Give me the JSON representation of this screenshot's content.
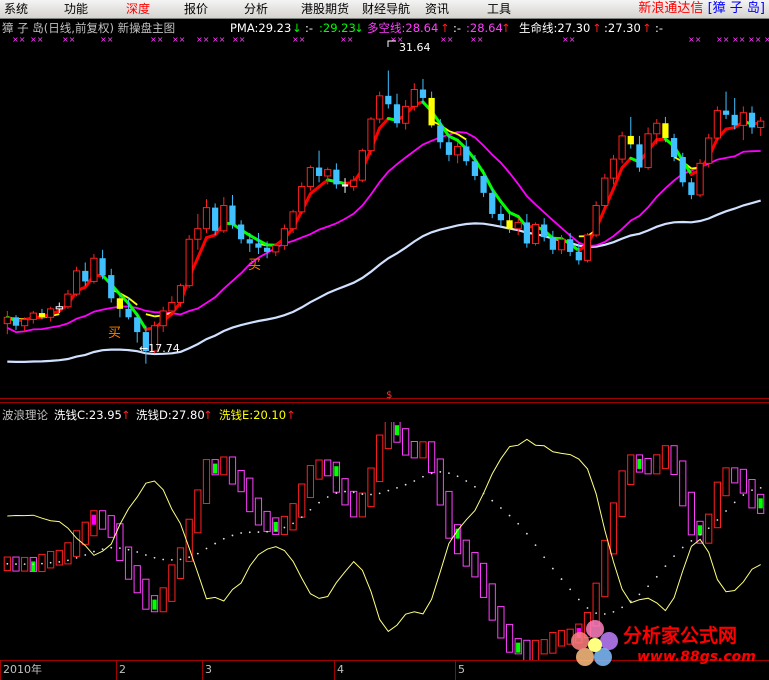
{
  "menu": {
    "items": [
      {
        "label": "系统",
        "key": "system"
      },
      {
        "label": "功能",
        "key": "function"
      },
      {
        "label": "深度",
        "key": "depth",
        "active": true
      },
      {
        "label": "报价",
        "key": "quote"
      },
      {
        "label": "分析",
        "key": "analysis"
      },
      {
        "label": "港股期货",
        "key": "hk-futures"
      },
      {
        "label": "财经导航",
        "key": "finance-nav"
      },
      {
        "label": "资讯",
        "key": "news"
      },
      {
        "label": "工具",
        "key": "tools"
      }
    ],
    "brand": "新浪通达信",
    "stock_box": "[獐 子 岛]"
  },
  "price_header": {
    "stock_title": "獐 子 岛(日线,前复权) 新操盘主图",
    "pma_label": "PMA:29.23",
    "pma_arrow": "↓",
    "pma_dash": ":-",
    "pma_value2": ":29.23",
    "pma_arrow2": "↓",
    "duokong_label": "多空线:28.64",
    "duokong_arrow": "↑",
    "duokong_dash": ":-",
    "duokong_value2": ":28.64",
    "duokong_arrow2": "↑",
    "life_label": "生命线:27.30",
    "life_arrow": "↑",
    "life_value2": ":27.30",
    "life_arrow2": "↑",
    "tail": ":-"
  },
  "price_annotations": {
    "high_label": "31.64",
    "low_label": "←17.74",
    "buy_label_1": "买",
    "buy_label_2": "买"
  },
  "separator_mark": "$",
  "wave_header": {
    "indicator_name": "波浪理论",
    "c_label": "洗钱C:23.95",
    "c_arrow": "↑",
    "d_label": "洗钱D:27.80",
    "d_arrow": "↑",
    "e_label": "洗钱E:20.10",
    "e_arrow": "↑"
  },
  "date_axis": [
    "2010年",
    "2",
    "3",
    "4",
    "5"
  ],
  "watermark": {
    "title": "分析家公式网",
    "url": "www.88gs.com"
  },
  "colors": {
    "up_candle": "#ff2020",
    "down_candle": "#40c0ff",
    "doji": "#ffffff",
    "ma_red": "#ff0000",
    "ma_green": "#00ff00",
    "ma_yellow": "#ffff00",
    "ma_magenta": "#ff00ff",
    "ma_life": "#d0e0ff",
    "gold": "#ffff00",
    "wave_up": "#ff2020",
    "wave_down": "#ff40ff",
    "wave_line": "#ffff80"
  },
  "chart_data": {
    "type": "candlestick",
    "price_ylim": [
      16.5,
      33
    ],
    "ohlc": [
      [
        19.6,
        20.2,
        19.1,
        19.9
      ],
      [
        19.9,
        20.0,
        19.3,
        19.5
      ],
      [
        19.5,
        19.9,
        19.2,
        19.8
      ],
      [
        19.8,
        20.2,
        19.6,
        20.1
      ],
      [
        20.1,
        20.3,
        19.8,
        19.9
      ],
      [
        19.9,
        20.4,
        19.7,
        20.3
      ],
      [
        20.3,
        20.6,
        20.1,
        20.4
      ],
      [
        20.4,
        21.2,
        20.3,
        21.0
      ],
      [
        21.0,
        22.3,
        20.9,
        22.1
      ],
      [
        22.1,
        22.5,
        21.4,
        21.6
      ],
      [
        21.6,
        22.9,
        21.5,
        22.7
      ],
      [
        22.7,
        23.1,
        21.7,
        21.9
      ],
      [
        21.9,
        22.2,
        20.6,
        20.8
      ],
      [
        20.8,
        21.0,
        19.9,
        20.3
      ],
      [
        20.3,
        20.8,
        19.8,
        19.9
      ],
      [
        19.9,
        20.1,
        18.7,
        19.2
      ],
      [
        19.2,
        19.5,
        17.7,
        18.3
      ],
      [
        18.3,
        19.7,
        18.2,
        19.5
      ],
      [
        19.5,
        20.4,
        19.2,
        20.2
      ],
      [
        20.2,
        20.9,
        20.0,
        20.6
      ],
      [
        20.6,
        21.5,
        20.4,
        21.4
      ],
      [
        21.4,
        23.8,
        21.3,
        23.6
      ],
      [
        23.6,
        24.8,
        23.1,
        24.1
      ],
      [
        24.1,
        25.5,
        23.9,
        25.1
      ],
      [
        25.1,
        25.3,
        23.8,
        24.0
      ],
      [
        24.0,
        25.6,
        23.9,
        25.2
      ],
      [
        25.2,
        25.7,
        24.1,
        24.3
      ],
      [
        24.3,
        24.5,
        23.4,
        23.6
      ],
      [
        23.6,
        23.9,
        23.0,
        23.4
      ],
      [
        23.4,
        23.9,
        22.9,
        23.2
      ],
      [
        23.2,
        23.5,
        22.7,
        23.0
      ],
      [
        23.0,
        23.4,
        22.8,
        23.3
      ],
      [
        23.3,
        24.3,
        23.1,
        24.1
      ],
      [
        24.1,
        25.0,
        23.9,
        24.9
      ],
      [
        24.9,
        26.3,
        24.8,
        26.1
      ],
      [
        26.1,
        27.1,
        25.9,
        27.0
      ],
      [
        27.0,
        27.8,
        26.3,
        26.6
      ],
      [
        26.6,
        27.0,
        26.2,
        26.9
      ],
      [
        26.9,
        27.2,
        26.0,
        26.2
      ],
      [
        26.2,
        26.5,
        25.8,
        26.1
      ],
      [
        26.1,
        26.6,
        25.9,
        26.4
      ],
      [
        26.4,
        27.9,
        26.3,
        27.8
      ],
      [
        27.8,
        29.4,
        27.6,
        29.3
      ],
      [
        29.3,
        30.6,
        29.1,
        30.4
      ],
      [
        30.4,
        31.6,
        29.8,
        30.0
      ],
      [
        30.0,
        30.5,
        28.9,
        29.1
      ],
      [
        29.1,
        30.2,
        28.8,
        29.9
      ],
      [
        29.9,
        31.0,
        29.7,
        30.7
      ],
      [
        30.7,
        31.2,
        30.0,
        30.3
      ],
      [
        30.3,
        30.6,
        28.9,
        29.0
      ],
      [
        29.0,
        29.3,
        27.9,
        28.2
      ],
      [
        28.2,
        28.5,
        27.3,
        27.6
      ],
      [
        27.6,
        28.2,
        27.2,
        28.0
      ],
      [
        28.0,
        28.3,
        27.1,
        27.3
      ],
      [
        27.3,
        27.6,
        26.4,
        26.6
      ],
      [
        26.6,
        26.9,
        25.6,
        25.8
      ],
      [
        25.8,
        26.0,
        24.6,
        24.8
      ],
      [
        24.8,
        25.2,
        24.2,
        24.5
      ],
      [
        24.5,
        24.9,
        23.9,
        24.1
      ],
      [
        24.1,
        24.6,
        23.8,
        24.4
      ],
      [
        24.4,
        24.8,
        23.2,
        23.4
      ],
      [
        23.4,
        24.4,
        23.3,
        24.3
      ],
      [
        24.3,
        24.6,
        23.5,
        23.7
      ],
      [
        23.7,
        24.0,
        22.9,
        23.1
      ],
      [
        23.1,
        23.8,
        22.9,
        23.6
      ],
      [
        23.6,
        23.9,
        22.8,
        23.0
      ],
      [
        23.0,
        23.4,
        22.4,
        22.6
      ],
      [
        22.6,
        23.9,
        22.5,
        23.8
      ],
      [
        23.8,
        25.4,
        23.7,
        25.2
      ],
      [
        25.2,
        26.7,
        25.1,
        26.5
      ],
      [
        26.5,
        27.6,
        26.2,
        27.4
      ],
      [
        27.4,
        28.7,
        27.2,
        28.5
      ],
      [
        28.5,
        29.4,
        27.9,
        28.1
      ],
      [
        28.1,
        28.5,
        26.8,
        27.0
      ],
      [
        27.0,
        28.9,
        26.9,
        28.6
      ],
      [
        28.6,
        29.3,
        28.1,
        29.1
      ],
      [
        29.1,
        29.4,
        28.2,
        28.4
      ],
      [
        28.4,
        28.6,
        27.3,
        27.5
      ],
      [
        27.5,
        27.7,
        26.1,
        26.3
      ],
      [
        26.3,
        26.5,
        25.5,
        25.7
      ],
      [
        25.7,
        27.4,
        25.6,
        27.2
      ],
      [
        27.2,
        28.6,
        27.0,
        28.4
      ],
      [
        28.4,
        29.9,
        28.3,
        29.7
      ],
      [
        29.7,
        30.6,
        29.3,
        29.5
      ],
      [
        29.5,
        30.3,
        28.8,
        29.0
      ],
      [
        29.0,
        29.9,
        28.3,
        29.6
      ],
      [
        29.6,
        29.9,
        28.6,
        28.9
      ],
      [
        28.9,
        29.4,
        28.5,
        29.2
      ]
    ]
  }
}
